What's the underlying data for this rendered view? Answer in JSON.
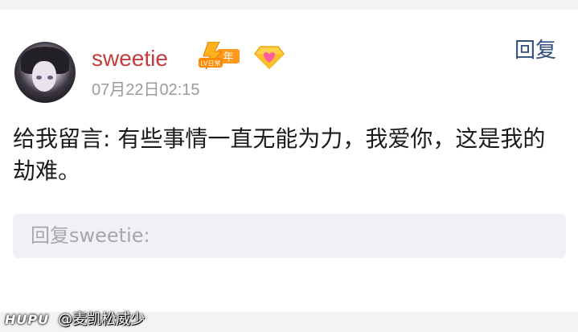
{
  "post": {
    "username": "sweetie",
    "timestamp": "07月22日02:15",
    "reply_label": "回复",
    "badge": {
      "level_text": "LV日常",
      "year_text": "年",
      "icon": "lightning-level-badge-icon"
    },
    "diamond_icon": "diamond-heart-icon",
    "comment_text": "给我留言: 有些事情一直无能为力，我爱你，这是我的劫难。",
    "reply_placeholder": "回复sweetie:"
  },
  "watermark": {
    "logo": "HUPU",
    "handle": "@麦凯松威少"
  },
  "colors": {
    "username": "#c23c3c",
    "reply_link": "#2f4f7a",
    "timestamp": "#9a9aa0",
    "placeholder": "#a6a6ad",
    "reply_box_bg": "#f1f1f5"
  }
}
